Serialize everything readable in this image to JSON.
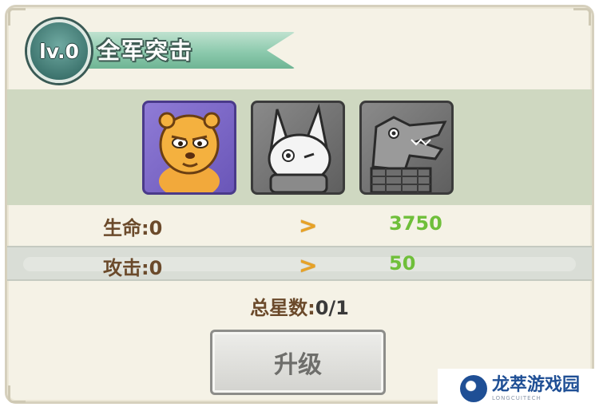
{
  "header": {
    "level_badge": "lv.0",
    "title": "全军突击"
  },
  "heroes": [
    {
      "name": "hamster-hero-card",
      "state": "active"
    },
    {
      "name": "rabbit-hero-card",
      "state": "locked"
    },
    {
      "name": "crocodile-hero-card",
      "state": "locked"
    }
  ],
  "stats": [
    {
      "label": "生命:0",
      "arrow": ">",
      "value": "3750"
    },
    {
      "label": "攻击:0",
      "arrow": ">",
      "value": "50"
    }
  ],
  "total_stars": {
    "label": "总星数:",
    "value": "0/1"
  },
  "upgrade_button": {
    "label": "升级"
  },
  "watermark": {
    "name": "龙萃游戏园",
    "url": "LONGCUITECH"
  },
  "colors": {
    "panel_bg": "#f5f2e6",
    "hero_band": "#cfd8c1",
    "label_brown": "#6b4a2b",
    "value_green": "#6fbf3a",
    "arrow_orange": "#e7a226",
    "badge_teal": "#3f7670"
  }
}
